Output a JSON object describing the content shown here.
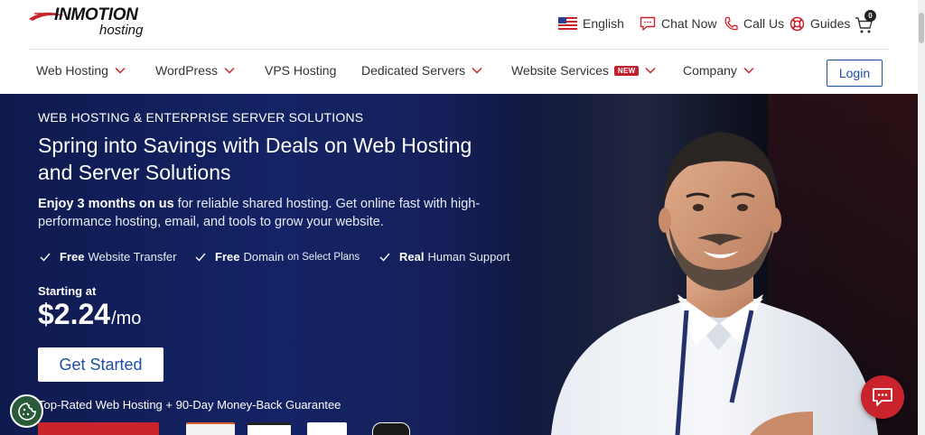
{
  "header": {
    "logo_main": "INMOTION",
    "logo_sub": "hosting",
    "utility": {
      "language": "English",
      "chat": "Chat Now",
      "call": "Call Us",
      "guides": "Guides",
      "cart_count": "0"
    }
  },
  "nav": {
    "items": [
      {
        "label": "Web Hosting",
        "has_dropdown": true
      },
      {
        "label": "WordPress",
        "has_dropdown": true
      },
      {
        "label": "VPS Hosting",
        "has_dropdown": false
      },
      {
        "label": "Dedicated Servers",
        "has_dropdown": true
      },
      {
        "label": "Website Services",
        "has_dropdown": true,
        "badge": "NEW"
      },
      {
        "label": "Company",
        "has_dropdown": true
      }
    ],
    "login": "Login"
  },
  "hero": {
    "eyebrow": "WEB HOSTING & ENTERPRISE SERVER SOLUTIONS",
    "headline": "Spring into Savings with Deals on Web Hosting and Server Solutions",
    "sub_bold": "Enjoy 3 months on us",
    "sub_rest": " for reliable shared hosting. Get online fast with high-performance hosting, email, and tools to grow your website.",
    "features": [
      {
        "bold": "Free",
        "text": "Website Transfer",
        "small": ""
      },
      {
        "bold": "Free",
        "text": "Domain",
        "small": "on Select Plans"
      },
      {
        "bold": "Real",
        "text": "Human Support",
        "small": ""
      }
    ],
    "starting_label": "Starting at",
    "price": "$2.24",
    "price_unit": "/mo",
    "cta": "Get Started",
    "guarantee": "Top-Rated Web Hosting + 90-Day Money-Back Guarantee"
  },
  "colors": {
    "brand_red": "#c9242b",
    "brand_blue": "#1e4fa6",
    "hero_bg": "#142365"
  },
  "icons": {
    "flag": "us-flag-icon",
    "chat": "chat-bubble-icon",
    "call": "phone-icon",
    "guides": "lifebuoy-icon",
    "cart": "cart-icon",
    "cookie": "cookie-icon",
    "chat_fab": "chat-fab-icon"
  }
}
